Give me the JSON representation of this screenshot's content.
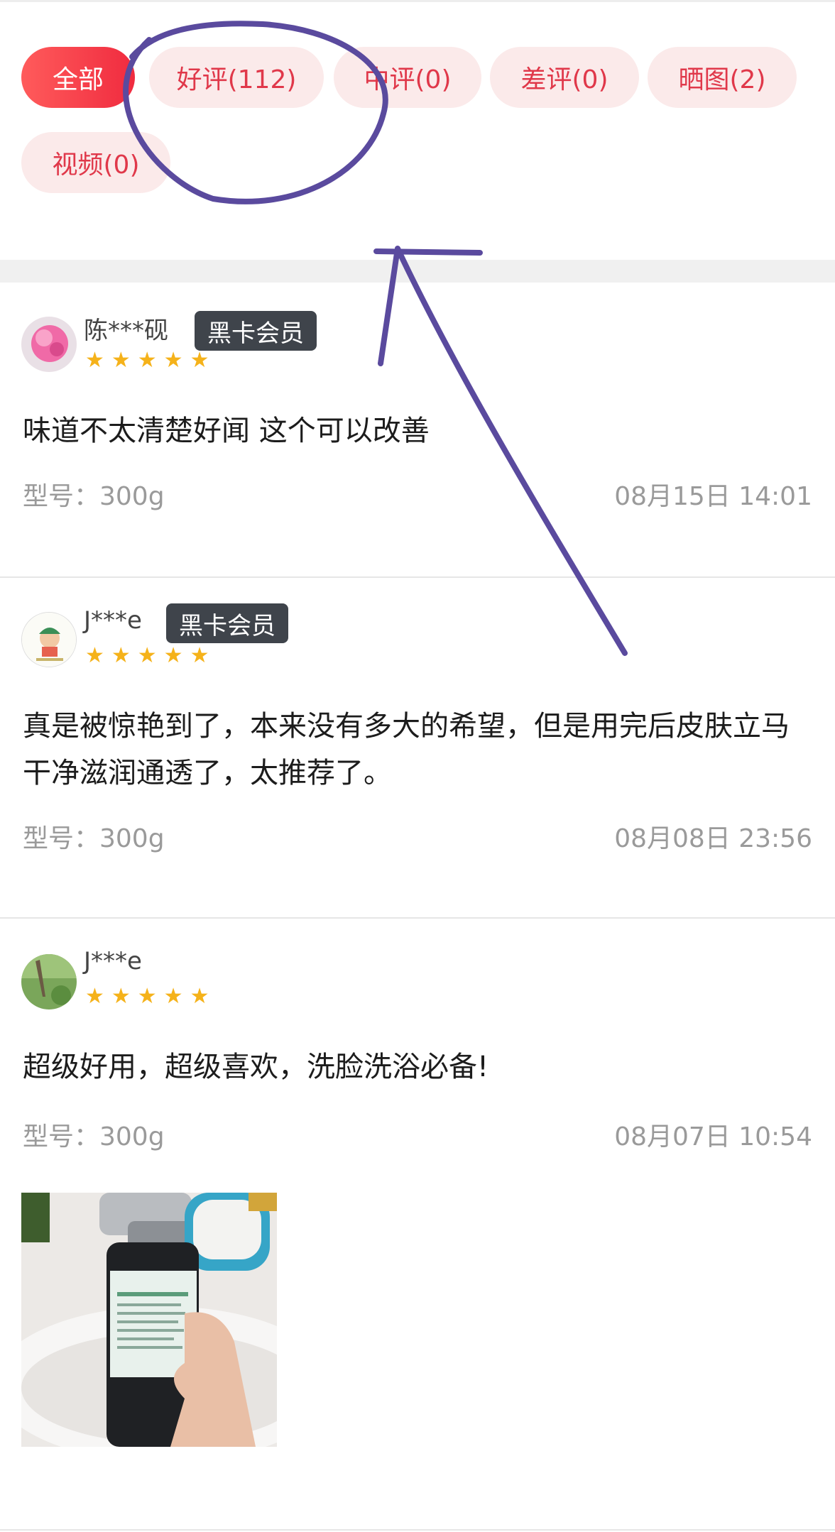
{
  "filters": [
    {
      "label": "全部",
      "active": true
    },
    {
      "label": "好评(112)",
      "active": false
    },
    {
      "label": "中评(0)",
      "active": false
    },
    {
      "label": "差评(0)",
      "active": false
    },
    {
      "label": "晒图(2)",
      "active": false
    },
    {
      "label": "视频(0)",
      "active": false
    }
  ],
  "reviews": [
    {
      "username": "陈***砚",
      "badge": "黑卡会员",
      "rating": 5,
      "stars": "★★★★★",
      "content": "味道不太清楚好闻 这个可以改善",
      "model": "型号：300g",
      "date": "08月15日 14:01"
    },
    {
      "username": "J***e",
      "badge": "黑卡会员",
      "rating": 5,
      "stars": "★★★★★",
      "content": "真是被惊艳到了，本来没有多大的希望，但是用完后皮肤立马干净滋润通透了，太推荐了。",
      "model": "型号：300g",
      "date": "08月08日 23:56"
    },
    {
      "username": "J***e",
      "rating": 5,
      "stars": "★★★★★",
      "content": "超级好用，超级喜欢，洗脸洗浴必备!",
      "model": "型号：300g",
      "date": "08月07日 10:54"
    }
  ],
  "colors": {
    "accent": "#f02b3f",
    "chip_bg": "#fbeaea",
    "star": "#f5b21a",
    "badge_bg": "#3f444b",
    "annotation": "#5a4a9e"
  }
}
